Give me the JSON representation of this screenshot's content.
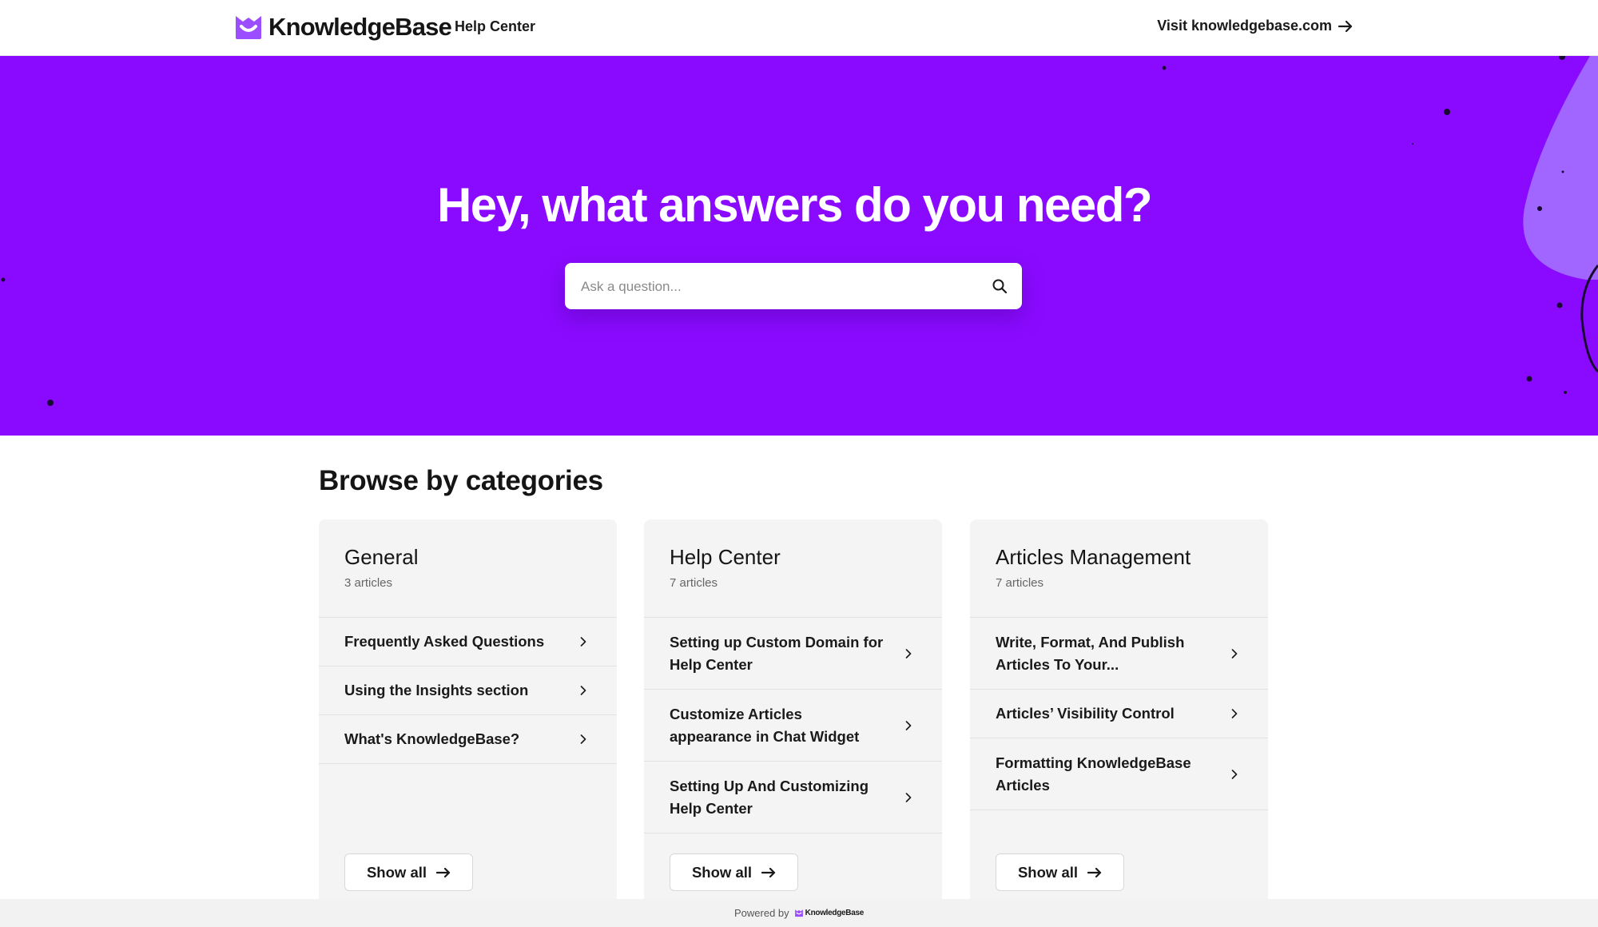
{
  "header": {
    "brand": "KnowledgeBase",
    "section_label": "Help Center",
    "visit_link": "Visit knowledgebase.com"
  },
  "hero": {
    "title": "Hey, what answers do you need?",
    "search_placeholder": "Ask a question..."
  },
  "categories_title": "Browse by categories",
  "categories": [
    {
      "title": "General",
      "count": "3 articles",
      "articles": [
        "Frequently Asked Questions",
        "Using the Insights section",
        "What's KnowledgeBase?"
      ],
      "show_all": "Show all"
    },
    {
      "title": "Help Center",
      "count": "7 articles",
      "articles": [
        "Setting up Custom Domain for Help Center",
        "Customize Articles appearance in Chat Widget",
        "Setting Up And Customizing Help Center"
      ],
      "show_all": "Show all"
    },
    {
      "title": "Articles Management",
      "count": "7 articles",
      "articles": [
        "Write, Format, And Publish Articles To Your...",
        "Articles’ Visibility Control",
        "Formatting KnowledgeBase Articles"
      ],
      "show_all": "Show all"
    }
  ],
  "footer": {
    "powered_by": "Powered by",
    "brand": "KnowledgeBase"
  },
  "colors": {
    "brand_purple": "#8a0aff",
    "logo_purple": "#9b4dff",
    "card_bg": "#f4f4f4"
  },
  "icons": [
    "logo-mark-icon",
    "arrow-right-icon",
    "search-icon",
    "chevron-right-icon"
  ]
}
